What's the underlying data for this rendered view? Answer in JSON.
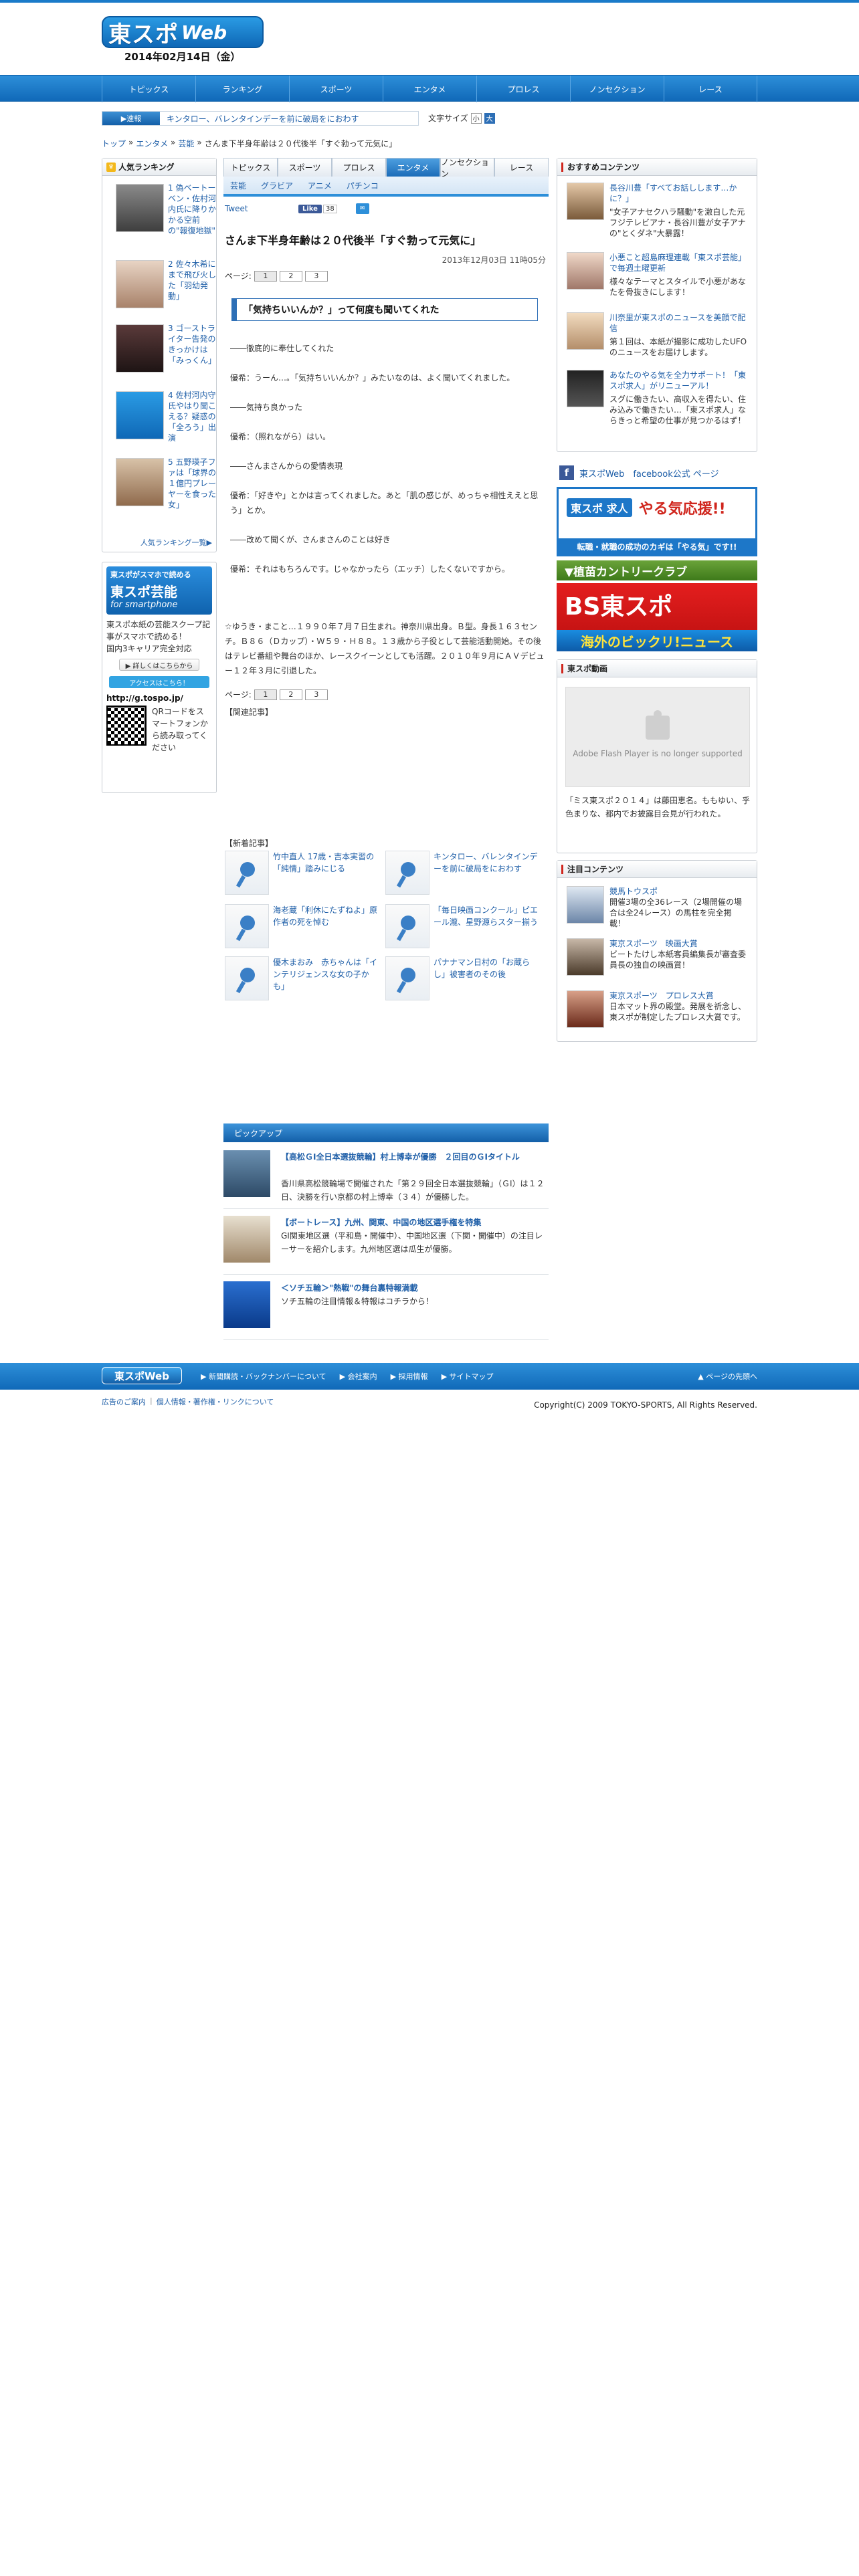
{
  "header": {
    "logo_main": "東スポ",
    "logo_sub": "Web",
    "date": "2014年02月14日（金）"
  },
  "nav": [
    "トピックス",
    "ランキング",
    "スポーツ",
    "エンタメ",
    "プロレス",
    "ノンセクション",
    "レース"
  ],
  "breaking": {
    "badge": "▶速報",
    "text": "キンタロー、バレンタインデーを前に破局をにおわす"
  },
  "textsize": {
    "label": "文字サイズ",
    "small": "小",
    "large": "大"
  },
  "breadcrumb": [
    "トップ",
    "エンタメ",
    "芸能",
    "さんま下半身年齢は２０代後半「すぐ勃って元気に」"
  ],
  "ranking": {
    "title": "人気ランキング",
    "items": [
      "1 偽ベートーベン・佐村河内氏に降りかかる空前の\"報復地獄\"",
      "2 佐々木希にまで飛び火した「羽幼発動」",
      "3 ゴーストライター告発のきっかけは「みっくん」",
      "4 佐村河内守氏やはり聞こえる？疑惑の「全ろう」出演",
      "5 五野瑛子ファは「球界の１億円プレーヤーを食った女」"
    ],
    "more": "人気ランキング一覧▶"
  },
  "smartphone": {
    "line1": "東スポがスマホで読める",
    "line2": "東スポ芸能",
    "line3": "for smartphone",
    "text": "東スポ本紙の芸能スクープ記事がスマホで読める！\n国内3キャリア完全対応",
    "btn_detail": "▶ 詳しくはこちらから",
    "btn_access": "アクセスはこちら！",
    "url": "http://g.tospo.jp/",
    "qr_text": "QRコードをスマートフォンから読み取ってください"
  },
  "category_tabs": [
    "トピックス",
    "スポーツ",
    "プロレス",
    "エンタメ",
    "ノンセクション",
    "レース"
  ],
  "active_tab": "エンタメ",
  "sub_tabs": [
    "芸能",
    "グラビア",
    "アニメ",
    "パチンコ"
  ],
  "share": {
    "tweet": "Tweet",
    "like": "Like",
    "like_count": "38",
    "share_icon": "✉"
  },
  "article": {
    "title": "さんま下半身年齢は２０代後半「すぐ勃って元気に」",
    "date": "2013年12月03日 11時05分",
    "page_label": "ページ:",
    "pages": [
      "1",
      "2",
      "3"
    ],
    "subhead": "「気持ちいいんか？」って何度も聞いてくれた",
    "paragraphs": [
      "――徹底的に奉仕してくれた",
      "優希：うーん…。「気持ちいいんか？」みたいなのは、よく聞いてくれました。",
      "――気持ち良かった",
      "優希：（照れながら）はい。",
      "――さんまさんからの愛情表現",
      "優希：「好きや」とかは言ってくれました。あと「肌の感じが、めっちゃ相性ええと思う」とか。",
      "――改めて聞くが、さんまさんのことは好き",
      "優希：それはもちろんです。じゃなかったら（エッチ）したくないですから。"
    ],
    "profile": "☆ゆうき・まこと…１９９０年７月７日生まれ。神奈川県出身。Ｂ型。身長１６３センチ。Ｂ８６（Ｄカップ）・Ｗ５９・Ｈ８８。１３歳から子役として芸能活動開始。その後はテレビ番組や舞台のほか、レースクイーンとしても活躍。２０１０年９月にＡＶデビュー１２年３月に引退した。",
    "related": "【関連記事】"
  },
  "new_articles": {
    "label": "【新着記事】",
    "items": [
      "竹中直人 17歳・吉本実習の「純情」踏みにじる",
      "キンタロー、バレンタインデーを前に破局をにおわす",
      "海老蔵「利休にたずねよ」原作者の死を悼む",
      "「毎日映画コンクール」ピエール瀧、星野源らスター揃う",
      "優木まおみ　赤ちゃんは「インテリジェンスな女の子かも」",
      "パナナマン日村の「お蔵らし」被害者のその後"
    ]
  },
  "pickup": {
    "label": "ピックアップ",
    "items": [
      {
        "title": "【高松ＧⅠ全日本選抜競輪】村上博幸が優勝　２回目のＧⅠタイトル",
        "desc": "香川県高松競輪場で開催された「第２９回全日本選抜競輪」（ＧⅠ）は１２日、決勝を行い京都の村上博幸（３４）が優勝した。"
      },
      {
        "title": "【ボートレース】九州、関東、中国の地区選手権を特集",
        "desc": "GI関東地区選（平和島・開催中）、中国地区選（下関・開催中）の注目レーサーを紹介します。九州地区選は瓜生が優勝。"
      },
      {
        "title": "＜ソチ五輪＞\"熱戦\"の舞台裏特報満載",
        "desc": "ソチ五輪の注目情報＆特報はコチラから！"
      }
    ]
  },
  "osusume": {
    "title": "おすすめコンテンツ",
    "items": [
      {
        "title": "長谷川豊「すべてお話しします…かに？」",
        "desc": "\"女子アナセクハラ騒動\"を激白した元フジテレビアナ・長谷川豊が女子アナの\"とくダネ\"大暴露！"
      },
      {
        "title": "小悪こと超島麻理連載「東スポ芸能」で毎週土曜更新",
        "desc": "様々なテーマとスタイルで小悪があなたを骨抜きにします！"
      },
      {
        "title": "川奈里が東スポのニュースを美顔で配信",
        "desc": "第１回は、本紙が撮影に成功したUFOのニュースをお届けします。"
      },
      {
        "title": "あなたのやる気を全力サポート！「東スポ求人」がリニューアル！",
        "desc": "スグに働きたい、高収入を得たい、住み込みで働きたい…「東スポ求人」ならきっと希望の仕事が見つかるはず！"
      }
    ]
  },
  "facebook_link": "東スポWeb　facebook公式 ページ",
  "banners": {
    "job_logo": "東スポ 求人",
    "job_main": "やる気応援!!",
    "job_bottom": "転職・就職の成功のカギは「やる気」です!!",
    "country": "▼植苗カントリークラブ",
    "bs_title": "BS東スポ",
    "bs_sub": "海外のビックリ!ニュース"
  },
  "video": {
    "title": "東スポ動画",
    "player_msg": "Adobe Flash Player is no longer supported",
    "caption": "「ミス東スポ２０１４」は藤田恵名。ももゆい、乎色まりな、都内でお披露目会見が行われた。"
  },
  "attention": {
    "title": "注目コンテンツ",
    "items": [
      {
        "title": "競馬トウスポ",
        "desc": "開催3場の全36レース（2場開催の場合は全24レース）の馬柱を完全掲載！"
      },
      {
        "title": "東京スポーツ　映画大賞",
        "desc": "ビートたけし本紙客員編集長が審査委員長の独自の映画賞！"
      },
      {
        "title": "東京スポーツ　プロレス大賞",
        "desc": "日本マット界の殿堂。発展を祈念し、東スポが制定したプロレス大賞です。"
      }
    ]
  },
  "footer": {
    "logo": "東スポWeb",
    "links": [
      "▶ 新聞購読・バックナンバーについて",
      "▶ 会社案内",
      "▶ 採用情報",
      "▶ サイトマップ"
    ],
    "top": "ページの先頭へ",
    "sub_links": [
      "広告のご案内",
      "|",
      "個人情報・著作権・リンクについて"
    ],
    "copyright": "Copyright(C) 2009 TOKYO-SPORTS, All Rights Reserved."
  },
  "colors": {
    "brand_blue": "#1a7bc9",
    "link_blue": "#1f5fa8",
    "accent_red": "#d0261d"
  }
}
